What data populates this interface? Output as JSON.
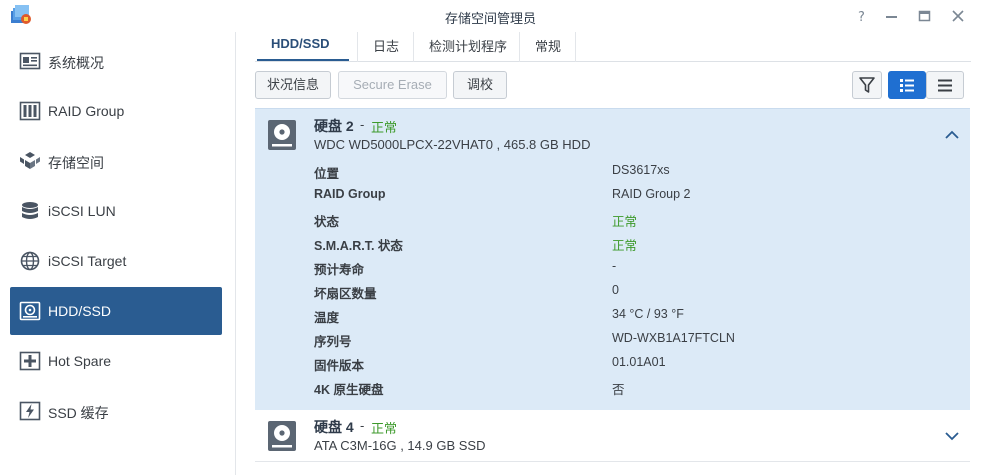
{
  "window": {
    "title": "存储空间管理员",
    "controls": [
      "help-icon",
      "pin-icon",
      "minimize-icon",
      "maximize-icon",
      "close-icon"
    ]
  },
  "sidebar": {
    "items": [
      {
        "label": "系统概况",
        "icon": "overview-icon",
        "active": false
      },
      {
        "label": "RAID Group",
        "icon": "raid-group-icon",
        "active": false
      },
      {
        "label": "存储空间",
        "icon": "volume-icon",
        "active": false
      },
      {
        "label": "iSCSI LUN",
        "icon": "iscsi-lun-icon",
        "active": false
      },
      {
        "label": "iSCSI Target",
        "icon": "iscsi-target-icon",
        "active": false
      },
      {
        "label": "HDD/SSD",
        "icon": "hdd-icon",
        "active": true
      },
      {
        "label": "Hot Spare",
        "icon": "hot-spare-icon",
        "active": false
      },
      {
        "label": "SSD 缓存",
        "icon": "ssd-cache-icon",
        "active": false
      }
    ]
  },
  "tabs": [
    {
      "label": "HDD/SSD",
      "active": true
    },
    {
      "label": "日志",
      "active": false
    },
    {
      "label": "检测计划程序",
      "active": false
    },
    {
      "label": "常规",
      "active": false
    }
  ],
  "toolbar": {
    "status_label": "状况信息",
    "secure_erase_label": "Secure Erase",
    "calibrate_label": "调校"
  },
  "disks": [
    {
      "name": "硬盘 2",
      "separator": " - ",
      "status": "正常",
      "model": "WDC WD5000LPCX-22VHAT0 , 465.8 GB HDD",
      "expanded": true,
      "properties": [
        {
          "label": "位置",
          "value": "DS3617xs",
          "ok": false
        },
        {
          "label": "RAID Group",
          "value": "RAID Group 2",
          "ok": false
        },
        {
          "label": "状态",
          "value": "正常",
          "ok": true
        },
        {
          "label": "S.M.A.R.T. 状态",
          "value": "正常",
          "ok": true
        },
        {
          "label": "预计寿命",
          "value": "-",
          "ok": false
        },
        {
          "label": "坏扇区数量",
          "value": "0",
          "ok": false
        },
        {
          "label": "温度",
          "value": "34 °C / 93 °F",
          "ok": false
        },
        {
          "label": "序列号",
          "value": "WD-WXB1A17FTCLN",
          "ok": false
        },
        {
          "label": "固件版本",
          "value": "01.01A01",
          "ok": false
        },
        {
          "label": "4K 原生硬盘",
          "value": "否",
          "ok": false
        }
      ]
    },
    {
      "name": "硬盘 4",
      "separator": " - ",
      "status": "正常",
      "model": "ATA C3M-16G , 14.9 GB SSD",
      "expanded": false
    }
  ],
  "colors": {
    "accent": "#2a5c91",
    "selected_button": "#1f6fd1",
    "expanded_bg": "#dceaf7",
    "ok_status": "#3d9a2b"
  }
}
